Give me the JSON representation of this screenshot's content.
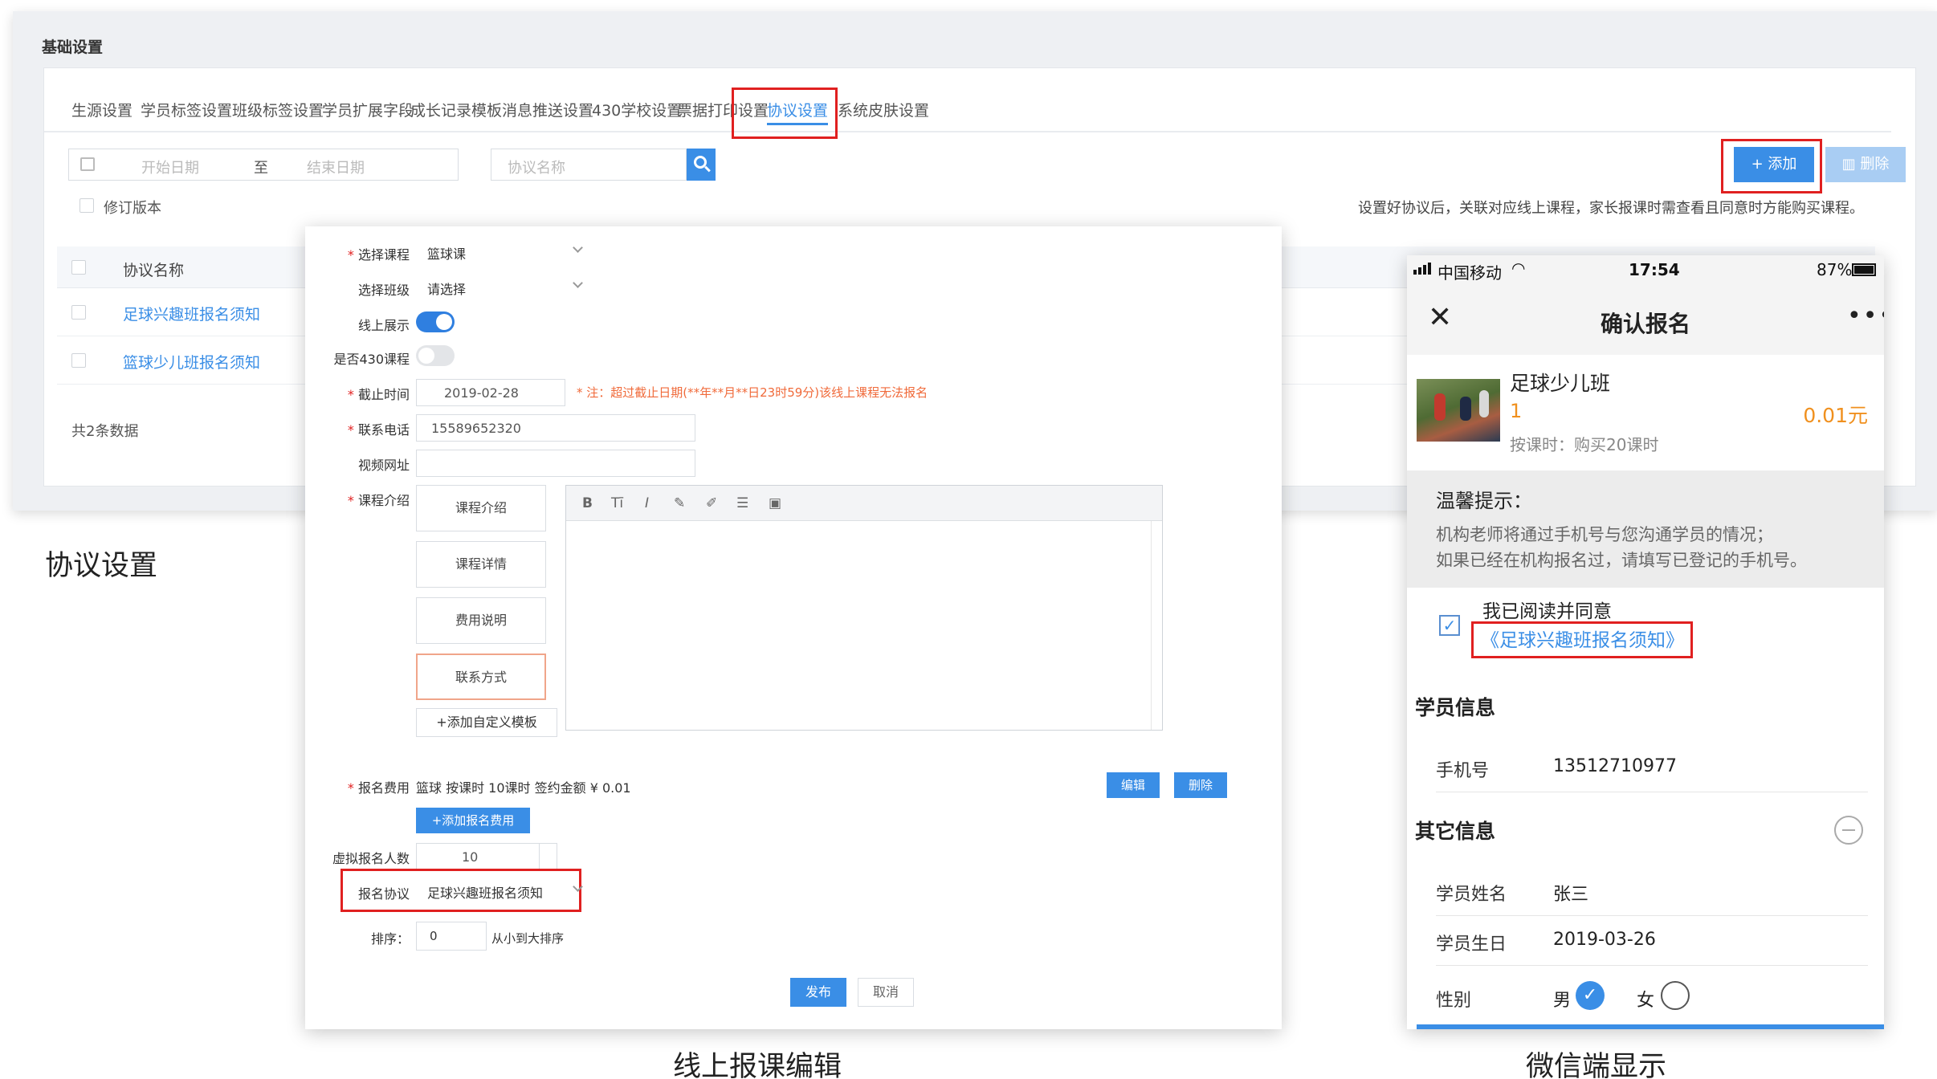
{
  "admin": {
    "title": "基础设置",
    "tabs": [
      {
        "label": "生源设置"
      },
      {
        "label": "学员标签设置"
      },
      {
        "label": "班级标签设置"
      },
      {
        "label": "学员扩展字段"
      },
      {
        "label": "成长记录模板"
      },
      {
        "label": "消息推送设置"
      },
      {
        "label": "430学校设置"
      },
      {
        "label": "票据打印设置"
      },
      {
        "label": "协议设置",
        "active": true
      },
      {
        "label": "系统皮肤设置"
      }
    ],
    "filters": {
      "start_placeholder": "开始日期",
      "to": "至",
      "end_placeholder": "结束日期",
      "name_placeholder": "协议名称"
    },
    "add_label": "+ 添加",
    "delete_label": "删除",
    "revision_label": "修订版本",
    "tip": "设置好协议后，关联对应线上课程，家长报课时需查看且同意时方能购买课程。",
    "table": {
      "header": "协议名称",
      "rows": [
        "足球兴趣班报名须知",
        "篮球少儿班报名须知"
      ]
    },
    "total": "共2条数据"
  },
  "captions": {
    "left": "协议设置",
    "middle": "线上报课编辑",
    "right": "微信端显示"
  },
  "form": {
    "labels": {
      "course": "选择课程",
      "class": "选择班级",
      "online": "线上展示",
      "is430": "是否430课程",
      "deadline": "截止时间",
      "phone": "联系电话",
      "video": "视频网址",
      "intro": "课程介绍",
      "fee": "报名费用",
      "virtual_count": "虚拟报名人数",
      "protocol": "报名协议",
      "sort": "排序："
    },
    "values": {
      "course": "篮球课",
      "class": "请选择",
      "deadline": "2019-02-28",
      "phone": "15589652320",
      "video": "",
      "virtual_count": "10",
      "protocol": "足球兴趣班报名须知",
      "sort": "0"
    },
    "online_enabled": true,
    "is430_enabled": false,
    "deadline_note": "* 注：超过截止日期(**年**月**日23时59分)该线上课程无法报名",
    "intro_tabs": [
      "课程介绍",
      "课程详情",
      "费用说明",
      "联系方式"
    ],
    "add_template": "+添加自定义模板",
    "fee_text": "篮球 按课时 10课时 签约金额 ¥ 0.01",
    "edit_label": "编辑",
    "delete_label": "删除",
    "add_fee": "+添加报名费用",
    "sort_tip": "从小到大排序",
    "publish": "发布",
    "cancel": "取消",
    "toolbar_icons": [
      "bold-icon",
      "text-size-icon",
      "italic-icon",
      "pen-icon",
      "brush-icon",
      "align-icon",
      "image-icon"
    ]
  },
  "phone": {
    "carrier": "中国移动",
    "time": "17:54",
    "battery": "87%",
    "title": "确认报名",
    "course": {
      "name": "足球少儿班",
      "qty": "1",
      "price": "0.01元",
      "unit": "按课时：购买20课时"
    },
    "tips": {
      "title": "温馨提示：",
      "line1": "机构老师将通过手机号与您沟通学员的情况；",
      "line2": "如果已经在机构报名过，请填写已登记的手机号。"
    },
    "agree": {
      "text": "我已阅读并同意",
      "link": "《足球兴趣班报名须知》",
      "checked": true
    },
    "student_info": {
      "title": "学员信息",
      "phone_label": "手机号",
      "phone_value": "13512710977"
    },
    "other_info": {
      "title": "其它信息",
      "name_label": "学员姓名",
      "name_value": "张三",
      "birthday_label": "学员生日",
      "birthday_value": "2019-03-26",
      "gender_label": "性别",
      "male": "男",
      "female": "女",
      "selected": "男"
    }
  },
  "colors": {
    "accent": "#3a8ee6",
    "highlight": "#e02020",
    "price": "#f0901e"
  }
}
